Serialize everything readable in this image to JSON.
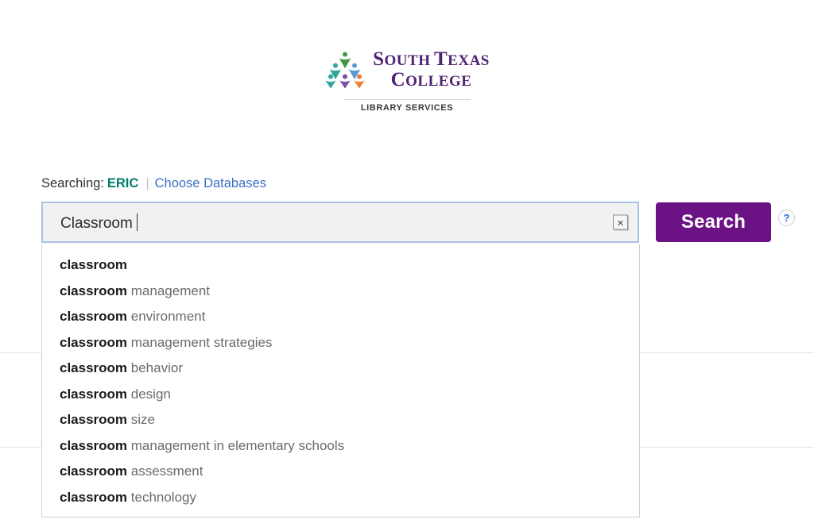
{
  "logo": {
    "mark_name": "south-texas-college-figures-logo",
    "line1_cap": "S",
    "line1_rest": "OUTH ",
    "line1_cap2": "T",
    "line1_rest2": "EXAS",
    "line2_cap": "C",
    "line2_rest": "OLLEGE",
    "line1_text": "SOUTH TEXAS",
    "line2_text": "COLLEGE",
    "subtitle": "LIBRARY SERVICES",
    "brand_color": "#4f2170",
    "figure_colors": [
      "#2fa89b",
      "#3f9a3f",
      "#5b9bd5",
      "#7b4ea8",
      "#ef8033"
    ]
  },
  "searching": {
    "label": "Searching:",
    "database": "ERIC",
    "separator": "|",
    "choose_databases_link": "Choose Databases",
    "database_color": "#00806b",
    "link_color": "#3c6fc4"
  },
  "search": {
    "value": "Classroom ",
    "placeholder": "",
    "clear_icon": "×",
    "button_label": "Search",
    "button_color": "#6b1385",
    "help_icon": "?"
  },
  "suggestions": {
    "match_prefix": "classroom",
    "items": [
      {
        "match": "classroom",
        "rest": ""
      },
      {
        "match": "classroom",
        "rest": " management"
      },
      {
        "match": "classroom",
        "rest": " environment"
      },
      {
        "match": "classroom",
        "rest": " management strategies"
      },
      {
        "match": "classroom",
        "rest": " behavior"
      },
      {
        "match": "classroom",
        "rest": " design"
      },
      {
        "match": "classroom",
        "rest": " size"
      },
      {
        "match": "classroom",
        "rest": " management in elementary schools"
      },
      {
        "match": "classroom",
        "rest": " assessment"
      },
      {
        "match": "classroom",
        "rest": " technology"
      }
    ]
  }
}
